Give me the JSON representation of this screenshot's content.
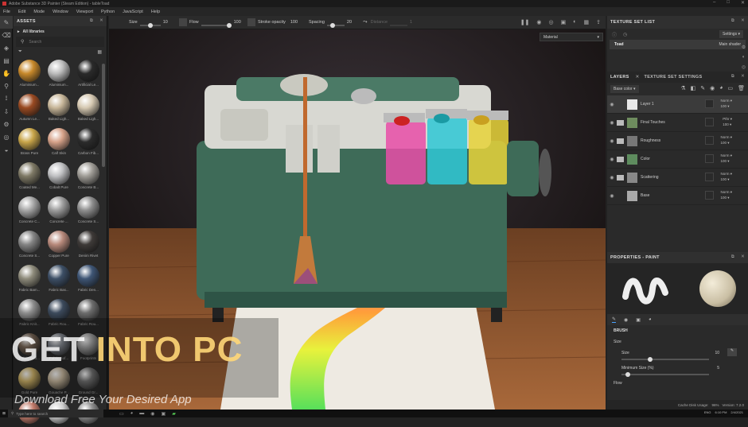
{
  "window": {
    "title": "Adobe Substance 3D Painter (Steam Edition) - tableToad"
  },
  "menu": [
    "File",
    "Edit",
    "Mode",
    "Window",
    "Viewport",
    "Python",
    "JavaScript",
    "Help"
  ],
  "toolbar": {
    "size_label": "Size",
    "size_value": "10",
    "flow_label": "Flow",
    "flow_value": "100",
    "stroke_label": "Stroke opacity",
    "stroke_value": "100",
    "spacing_label": "Spacing",
    "spacing_value": "20",
    "distance_label": "Distance",
    "distance_value": "1"
  },
  "assets": {
    "title": "ASSETS",
    "scope": "All libraries",
    "search_placeholder": "Search",
    "items": [
      {
        "label": "Aluminium...",
        "color": "#c8892b"
      },
      {
        "label": "Aluminium...",
        "color": "#bdbdbd"
      },
      {
        "label": "Artificial Le...",
        "color": "#2a2a2a"
      },
      {
        "label": "Autumn Le...",
        "color": "#9a4a22"
      },
      {
        "label": "Baked Ligh...",
        "color": "#c8b79a"
      },
      {
        "label": "Baked Ligh...",
        "color": "#d6c9b2"
      },
      {
        "label": "Brass Pure",
        "color": "#c9a64a"
      },
      {
        "label": "Calf Skin",
        "color": "#d7a38a"
      },
      {
        "label": "Carbon Fib...",
        "color": "#2b2b2b"
      },
      {
        "label": "Coated Me...",
        "color": "#7f7a66"
      },
      {
        "label": "Cobalt Pure",
        "color": "#bfc0c2"
      },
      {
        "label": "Concrete B...",
        "color": "#a09d97"
      },
      {
        "label": "Concrete C...",
        "color": "#a8a8a8"
      },
      {
        "label": "Concrete ...",
        "color": "#9d9d9d"
      },
      {
        "label": "Concrete S...",
        "color": "#8e8e8e"
      },
      {
        "label": "Concrete S...",
        "color": "#858585"
      },
      {
        "label": "Copper Pure",
        "color": "#b88a7c"
      },
      {
        "label": "Denim Rivet",
        "color": "#3e3a38"
      },
      {
        "label": "Fabric Bam...",
        "color": "#8e8b7b"
      },
      {
        "label": "Fabric Bas...",
        "color": "#3d4f66"
      },
      {
        "label": "Fabric Den...",
        "color": "#3e5575"
      },
      {
        "label": "Fabric Knit...",
        "color": "#8e8e8e"
      },
      {
        "label": "Fabric Rou...",
        "color": "#3c4a5c"
      },
      {
        "label": "Fabric Rou...",
        "color": "#6d6d6d"
      },
      {
        "label": "Fabric Rou...",
        "color": "#7d6a5a"
      },
      {
        "label": "Fabric Sof...",
        "color": "#858a92"
      },
      {
        "label": "Footprints",
        "color": "#a4a4a4"
      },
      {
        "label": "Gold Pure",
        "color": "#d1b56a"
      },
      {
        "label": "Gouache P...",
        "color": "#c9b99f"
      },
      {
        "label": "Ground Gr...",
        "color": "#747474"
      },
      {
        "label": "",
        "color": "#c07a6a"
      },
      {
        "label": "",
        "color": "#cfcfcf"
      },
      {
        "label": "",
        "color": "#8d8d8d"
      }
    ]
  },
  "viewport": {
    "mode_select": "Material"
  },
  "texture_set_list": {
    "title": "TEXTURE SET LIST",
    "settings": "Settings",
    "set_name": "Toad",
    "shader": "Main shader"
  },
  "layers": {
    "tab_layers": "LAYERS",
    "tab_tss": "TEXTURE SET SETTINGS",
    "channel": "Base color",
    "rows": [
      {
        "name": "Layer 1",
        "blend": "Norm",
        "opacity": "100",
        "thumb": "#e8e8e8",
        "folder": false
      },
      {
        "name": "Final Touches",
        "blend": "Pthr",
        "opacity": "100",
        "thumb": "#6e8c5e",
        "folder": true
      },
      {
        "name": "Roughness",
        "blend": "Norm",
        "opacity": "100",
        "thumb": "#777",
        "folder": true
      },
      {
        "name": "Color",
        "blend": "Norm",
        "opacity": "100",
        "thumb": "#5e8c5e",
        "folder": true
      },
      {
        "name": "Scattering",
        "blend": "Norm",
        "opacity": "100",
        "thumb": "#888",
        "folder": true
      },
      {
        "name": "Base",
        "blend": "Norm",
        "opacity": "100",
        "thumb": "#aaa",
        "folder": false
      }
    ]
  },
  "properties": {
    "title": "PROPERTIES - PAINT",
    "brush_heading": "BRUSH",
    "size_label": "Size",
    "size_value": "10",
    "min_size_label": "Minimum Size (%)",
    "min_size_value": "5",
    "flow_label": "Flow"
  },
  "status": {
    "cache": "Cache Disk Usage:",
    "cache_value": "96%",
    "version": "Version: 7.2.0"
  },
  "taskbar": {
    "search_placeholder": "Type here to search",
    "lang": "ENG",
    "time": "6:10 PM",
    "date": "2/4/2021"
  },
  "watermark": {
    "brand_a": "GET",
    "brand_b": "INTO PC",
    "tagline": "Download Free Your Desired App"
  }
}
